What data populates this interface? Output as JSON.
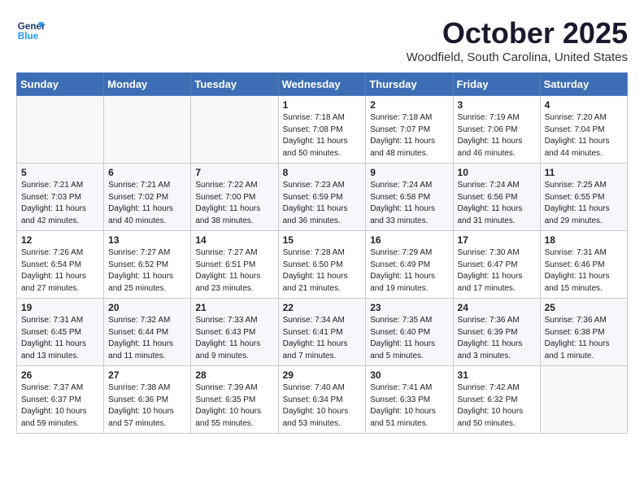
{
  "header": {
    "logo_line1": "General",
    "logo_line2": "Blue",
    "month": "October 2025",
    "location": "Woodfield, South Carolina, United States"
  },
  "weekdays": [
    "Sunday",
    "Monday",
    "Tuesday",
    "Wednesday",
    "Thursday",
    "Friday",
    "Saturday"
  ],
  "weeks": [
    [
      {
        "day": "",
        "info": ""
      },
      {
        "day": "",
        "info": ""
      },
      {
        "day": "",
        "info": ""
      },
      {
        "day": "1",
        "info": "Sunrise: 7:18 AM\nSunset: 7:08 PM\nDaylight: 11 hours\nand 50 minutes."
      },
      {
        "day": "2",
        "info": "Sunrise: 7:18 AM\nSunset: 7:07 PM\nDaylight: 11 hours\nand 48 minutes."
      },
      {
        "day": "3",
        "info": "Sunrise: 7:19 AM\nSunset: 7:06 PM\nDaylight: 11 hours\nand 46 minutes."
      },
      {
        "day": "4",
        "info": "Sunrise: 7:20 AM\nSunset: 7:04 PM\nDaylight: 11 hours\nand 44 minutes."
      }
    ],
    [
      {
        "day": "5",
        "info": "Sunrise: 7:21 AM\nSunset: 7:03 PM\nDaylight: 11 hours\nand 42 minutes."
      },
      {
        "day": "6",
        "info": "Sunrise: 7:21 AM\nSunset: 7:02 PM\nDaylight: 11 hours\nand 40 minutes."
      },
      {
        "day": "7",
        "info": "Sunrise: 7:22 AM\nSunset: 7:00 PM\nDaylight: 11 hours\nand 38 minutes."
      },
      {
        "day": "8",
        "info": "Sunrise: 7:23 AM\nSunset: 6:59 PM\nDaylight: 11 hours\nand 36 minutes."
      },
      {
        "day": "9",
        "info": "Sunrise: 7:24 AM\nSunset: 6:58 PM\nDaylight: 11 hours\nand 33 minutes."
      },
      {
        "day": "10",
        "info": "Sunrise: 7:24 AM\nSunset: 6:56 PM\nDaylight: 11 hours\nand 31 minutes."
      },
      {
        "day": "11",
        "info": "Sunrise: 7:25 AM\nSunset: 6:55 PM\nDaylight: 11 hours\nand 29 minutes."
      }
    ],
    [
      {
        "day": "12",
        "info": "Sunrise: 7:26 AM\nSunset: 6:54 PM\nDaylight: 11 hours\nand 27 minutes."
      },
      {
        "day": "13",
        "info": "Sunrise: 7:27 AM\nSunset: 6:52 PM\nDaylight: 11 hours\nand 25 minutes."
      },
      {
        "day": "14",
        "info": "Sunrise: 7:27 AM\nSunset: 6:51 PM\nDaylight: 11 hours\nand 23 minutes."
      },
      {
        "day": "15",
        "info": "Sunrise: 7:28 AM\nSunset: 6:50 PM\nDaylight: 11 hours\nand 21 minutes."
      },
      {
        "day": "16",
        "info": "Sunrise: 7:29 AM\nSunset: 6:49 PM\nDaylight: 11 hours\nand 19 minutes."
      },
      {
        "day": "17",
        "info": "Sunrise: 7:30 AM\nSunset: 6:47 PM\nDaylight: 11 hours\nand 17 minutes."
      },
      {
        "day": "18",
        "info": "Sunrise: 7:31 AM\nSunset: 6:46 PM\nDaylight: 11 hours\nand 15 minutes."
      }
    ],
    [
      {
        "day": "19",
        "info": "Sunrise: 7:31 AM\nSunset: 6:45 PM\nDaylight: 11 hours\nand 13 minutes."
      },
      {
        "day": "20",
        "info": "Sunrise: 7:32 AM\nSunset: 6:44 PM\nDaylight: 11 hours\nand 11 minutes."
      },
      {
        "day": "21",
        "info": "Sunrise: 7:33 AM\nSunset: 6:43 PM\nDaylight: 11 hours\nand 9 minutes."
      },
      {
        "day": "22",
        "info": "Sunrise: 7:34 AM\nSunset: 6:41 PM\nDaylight: 11 hours\nand 7 minutes."
      },
      {
        "day": "23",
        "info": "Sunrise: 7:35 AM\nSunset: 6:40 PM\nDaylight: 11 hours\nand 5 minutes."
      },
      {
        "day": "24",
        "info": "Sunrise: 7:36 AM\nSunset: 6:39 PM\nDaylight: 11 hours\nand 3 minutes."
      },
      {
        "day": "25",
        "info": "Sunrise: 7:36 AM\nSunset: 6:38 PM\nDaylight: 11 hours\nand 1 minute."
      }
    ],
    [
      {
        "day": "26",
        "info": "Sunrise: 7:37 AM\nSunset: 6:37 PM\nDaylight: 10 hours\nand 59 minutes."
      },
      {
        "day": "27",
        "info": "Sunrise: 7:38 AM\nSunset: 6:36 PM\nDaylight: 10 hours\nand 57 minutes."
      },
      {
        "day": "28",
        "info": "Sunrise: 7:39 AM\nSunset: 6:35 PM\nDaylight: 10 hours\nand 55 minutes."
      },
      {
        "day": "29",
        "info": "Sunrise: 7:40 AM\nSunset: 6:34 PM\nDaylight: 10 hours\nand 53 minutes."
      },
      {
        "day": "30",
        "info": "Sunrise: 7:41 AM\nSunset: 6:33 PM\nDaylight: 10 hours\nand 51 minutes."
      },
      {
        "day": "31",
        "info": "Sunrise: 7:42 AM\nSunset: 6:32 PM\nDaylight: 10 hours\nand 50 minutes."
      },
      {
        "day": "",
        "info": ""
      }
    ]
  ]
}
